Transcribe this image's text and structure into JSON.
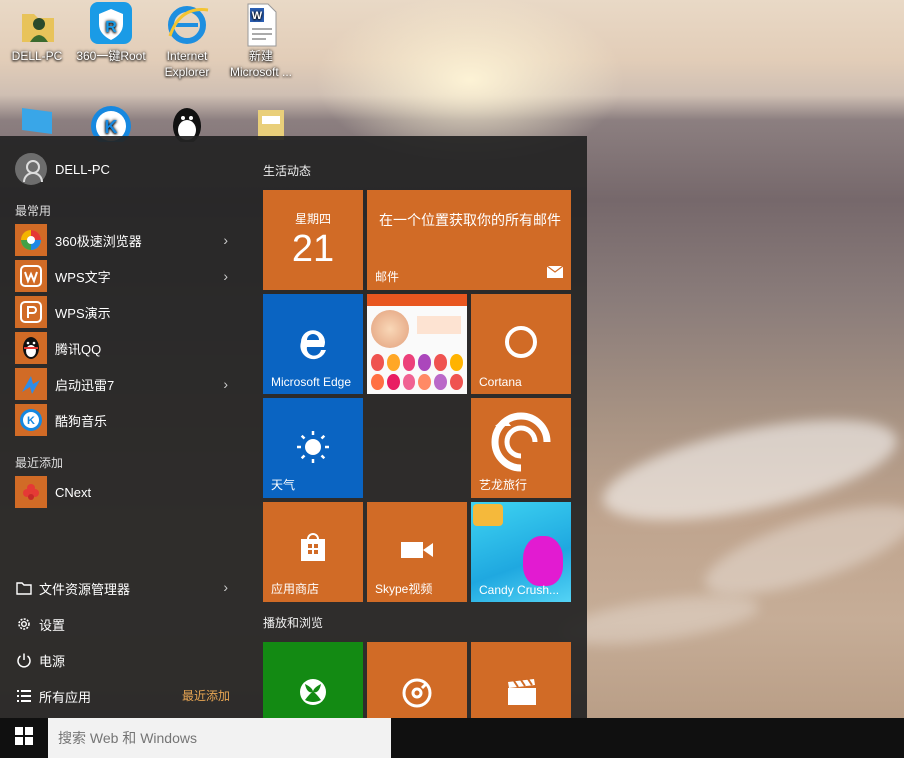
{
  "desktop": {
    "icons": [
      {
        "label": "DELL-PC",
        "icon": "user-folder-icon"
      },
      {
        "label": "360一键Root",
        "icon": "root-shield-icon"
      },
      {
        "label": "Internet Explorer",
        "icon": "internet-explorer-icon"
      },
      {
        "label": "新建 Microsoft ...",
        "icon": "word-document-icon"
      },
      {
        "label": "",
        "icon": "computer-monitor-icon"
      },
      {
        "label": "",
        "icon": "kugou-icon"
      },
      {
        "label": "",
        "icon": "qq-penguin-icon"
      },
      {
        "label": "",
        "icon": "folder-icon"
      }
    ]
  },
  "start_menu": {
    "user": "DELL-PC",
    "most_used_label": "最常用",
    "most_used": [
      {
        "label": "360极速浏览器",
        "icon": "360-browser-icon",
        "has_submenu": true,
        "color": "#d16b26"
      },
      {
        "label": "WPS文字",
        "icon": "wps-writer-icon",
        "has_submenu": true,
        "color": "#d16b26"
      },
      {
        "label": "WPS演示",
        "icon": "wps-presentation-icon",
        "has_submenu": false,
        "color": "#d16b26"
      },
      {
        "label": "腾讯QQ",
        "icon": "qq-penguin-icon",
        "has_submenu": false,
        "color": "#d16b26"
      },
      {
        "label": "启动迅雷7",
        "icon": "thunder-icon",
        "has_submenu": true,
        "color": "#d16b26"
      },
      {
        "label": "酷狗音乐",
        "icon": "kugou-icon",
        "has_submenu": false,
        "color": "#d16b26"
      }
    ],
    "recently_added_label": "最近添加",
    "recently_added": [
      {
        "label": "CNext",
        "icon": "cnext-icon",
        "color": "#d16b26"
      }
    ],
    "system": {
      "file_explorer": "文件资源管理器",
      "settings": "设置",
      "power": "电源",
      "all_apps": "所有应用",
      "recent_link": "最近添加"
    },
    "tile_groups": {
      "life": "生活动态",
      "play": "播放和浏览"
    },
    "tiles": {
      "calendar": {
        "weekday": "星期四",
        "day": "21"
      },
      "mail": {
        "text": "在一个位置获取你的所有邮件",
        "label": "邮件"
      },
      "edge": {
        "label": "Microsoft Edge"
      },
      "cortana": {
        "label": "Cortana"
      },
      "weather": {
        "label": "天气"
      },
      "elong": {
        "label": "艺龙旅行"
      },
      "store": {
        "label": "应用商店"
      },
      "skype": {
        "label": "Skype视频"
      },
      "candy": {
        "label": "Candy Crush..."
      }
    }
  },
  "taskbar": {
    "search_placeholder": "搜索 Web 和 Windows"
  },
  "colors": {
    "tile_orange": "#d16b26",
    "tile_blue": "#0a64c2",
    "tile_green": "#138a13",
    "accent_link": "#e8a653"
  }
}
